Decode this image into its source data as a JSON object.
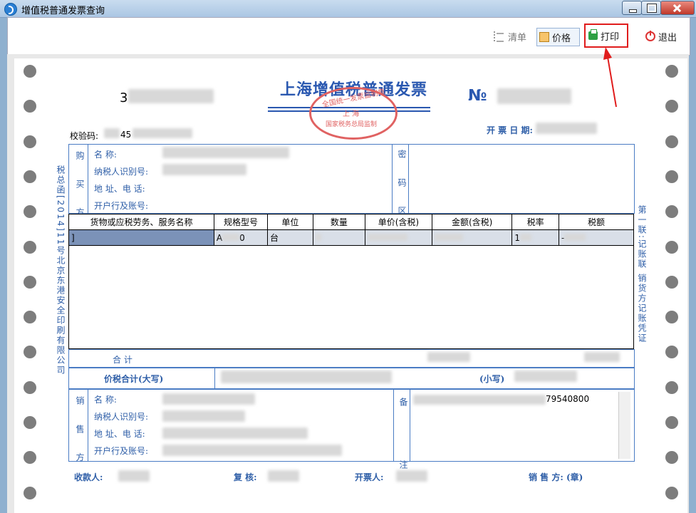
{
  "window": {
    "title": "增值税普通发票查询"
  },
  "toolbar": {
    "list_label": "清单",
    "price_label": "价格",
    "print_label": "打印",
    "exit_label": "退出"
  },
  "invoice": {
    "title": "上海增值税普通发票",
    "seal_text_top": "全国统一发票监制章",
    "seal_text_mid": "上 海",
    "seal_text_bottom": "国家税务总局监制",
    "number_sign": "№",
    "code_prefix": "3",
    "check_code_label": "校验码:",
    "check_code_partial": "45",
    "date_label": "开 票 日 期:",
    "left_margin_text": "税总函[2014]11号北京东港安全印刷有限公司",
    "right_margin_text": "第一联:记账联 销货方记账凭证",
    "buyer": {
      "side_label": "购 买 方",
      "name_label": "名    称:",
      "taxid_label": "纳税人识别号:",
      "address_label": "地 址、电 话:",
      "bank_label": "开户行及账号:"
    },
    "password_area_label": "密 码 区",
    "items": {
      "headers": [
        "货物或应税劳务、服务名称",
        "规格型号",
        "单位",
        "数量",
        "单价(含税)",
        "金额(含税)",
        "税率",
        "税额"
      ],
      "rows": [
        {
          "name": "]",
          "spec": "A",
          "spec_tail": "0",
          "unit": "台",
          "qty": "",
          "price": "",
          "amount": "",
          "rate": "1",
          "tax": "-"
        }
      ]
    },
    "total_label": "合      计",
    "total_tax_label": "价税合计(大写)",
    "small_label": "(小写)",
    "seller": {
      "side_label": "销 售 方",
      "name_label": "名    称:",
      "taxid_label": "纳税人识别号:",
      "address_label": "地 址、电 话:",
      "bank_label": "开户行及账号:"
    },
    "remark_label": "备 注",
    "remark_tail": "79540800",
    "payee_label": "收款人:",
    "reviewer_label": "复  核:",
    "drawer_label": "开票人:",
    "seller_seal_label": "销 售 方: (章)"
  }
}
